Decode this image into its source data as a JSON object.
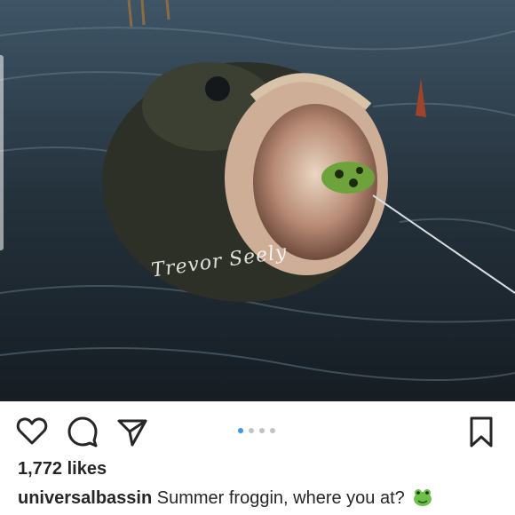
{
  "post": {
    "photo": {
      "description_icon": "fish-photo",
      "watermark": "Trevor Seely"
    },
    "actions": {
      "like_icon": "heart-icon",
      "comment_icon": "comment-icon",
      "share_icon": "send-icon",
      "save_icon": "bookmark-icon"
    },
    "carousel": {
      "total": 4,
      "active": 1,
      "active_color": "#3897f0",
      "inactive_color": "#c2c2c2"
    },
    "likes_text": "1,772 likes",
    "caption": {
      "username": "universalbassin",
      "text": "Summer froggin, where you at?",
      "emoji": "frog-icon"
    }
  }
}
